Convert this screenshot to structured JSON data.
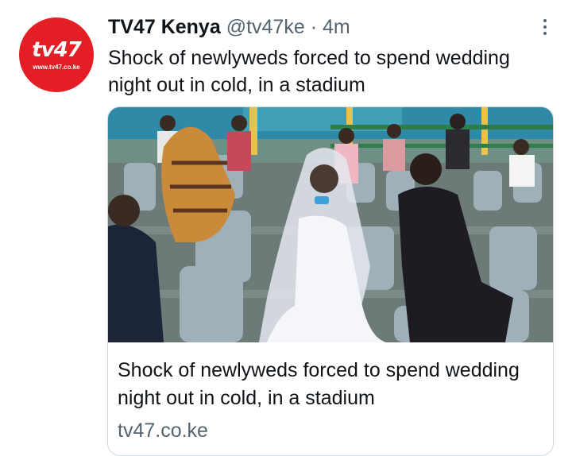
{
  "tweet": {
    "author_name": "TV47 Kenya",
    "handle": "@tv47ke",
    "separator": "·",
    "time": "4m",
    "text": "Shock of newlyweds forced to spend wedding night out in cold, in a stadium"
  },
  "avatar": {
    "logo_text": "tv47",
    "url_text": "www.tv47.co.ke",
    "color": "#e31e24"
  },
  "card": {
    "title": "Shock of newlyweds forced to spend wedding night out in cold, in a stadium",
    "domain": "tv47.co.ke"
  },
  "icons": {
    "more": "more-vertical-icon"
  },
  "colors": {
    "text": "#0f1419",
    "secondary": "#536471",
    "border": "#cfd9de"
  }
}
